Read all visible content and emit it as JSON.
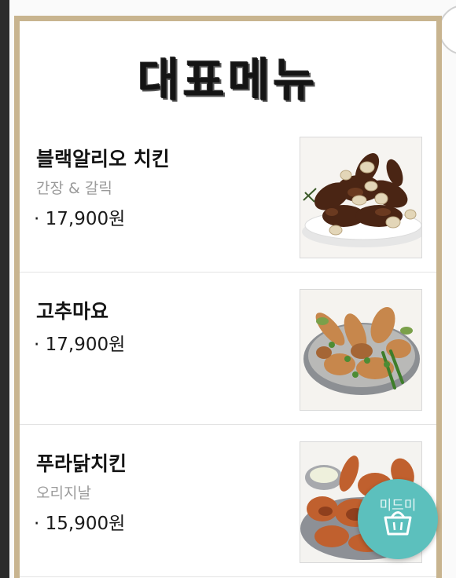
{
  "title": "대표메뉴",
  "menu": [
    {
      "name": "블랙알리오 치킨",
      "description": "간장 & 갈릭",
      "price": "· 17,900원",
      "image": "black-alio-chicken-photo"
    },
    {
      "name": "고추마요",
      "description": "",
      "price": "· 17,900원",
      "image": "gochu-mayo-chicken-photo"
    },
    {
      "name": "푸라닭치킨",
      "description": "오리지날",
      "price": "· 15,900원",
      "image": "puradak-chicken-photo"
    }
  ],
  "cart": {
    "label": "미드미",
    "icon": "basket-icon"
  },
  "colors": {
    "frame": "#c8b48f",
    "cart": "#5cc0bd",
    "description": "#9a9a9a"
  }
}
